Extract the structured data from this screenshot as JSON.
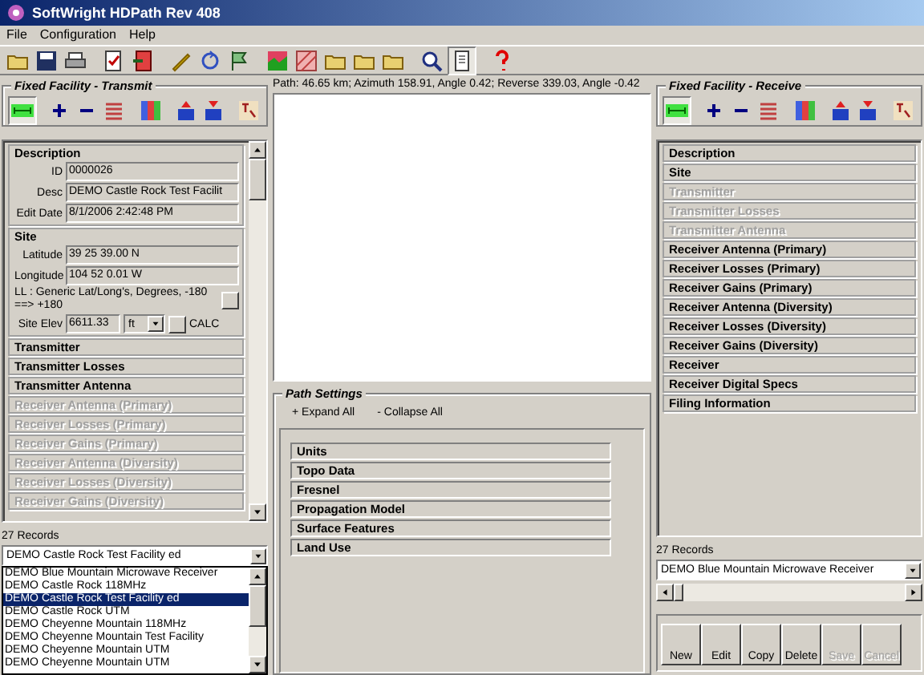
{
  "window": {
    "title": "SoftWright HDPath Rev 408"
  },
  "menu": [
    "File",
    "Configuration",
    "Help"
  ],
  "transmit": {
    "title": "Fixed Facility - Transmit",
    "sections": [
      {
        "title": "Description",
        "disabled": false,
        "fields": [
          {
            "label": "ID",
            "value": "0000026"
          },
          {
            "label": "Desc",
            "value": "DEMO Castle Rock Test Facilit"
          },
          {
            "label": "Edit Date",
            "value": "8/1/2006 2:42:48 PM"
          }
        ]
      },
      {
        "title": "Site",
        "disabled": false,
        "fields": [
          {
            "label": "Latitude",
            "value": "39 25 39.00 N"
          },
          {
            "label": "Longitude",
            "value": "104 52 0.01 W"
          }
        ],
        "note": "LL : Generic Lat/Long's, Degrees, -180 ==> +180",
        "elevation": {
          "label": "Site Elev",
          "value": "6611.33",
          "unit": "ft",
          "action": "CALC"
        }
      },
      {
        "title": "Transmitter",
        "disabled": false
      },
      {
        "title": "Transmitter Losses",
        "disabled": false
      },
      {
        "title": "Transmitter Antenna",
        "disabled": false
      },
      {
        "title": "Receiver Antenna (Primary)",
        "disabled": true
      },
      {
        "title": "Receiver Losses (Primary)",
        "disabled": true
      },
      {
        "title": "Receiver Gains (Primary)",
        "disabled": true
      },
      {
        "title": "Receiver Antenna (Diversity)",
        "disabled": true
      },
      {
        "title": "Receiver Losses (Diversity)",
        "disabled": true
      },
      {
        "title": "Receiver Gains (Diversity)",
        "disabled": true
      }
    ],
    "records": "27 Records",
    "combo": "DEMO Castle Rock Test Facility ed",
    "list": [
      {
        "text": "DEMO Blue Mountain Microwave Receiver",
        "selected": false
      },
      {
        "text": "DEMO Castle Rock 118MHz",
        "selected": false
      },
      {
        "text": "DEMO Castle Rock Test Facility ed",
        "selected": true
      },
      {
        "text": "DEMO Castle Rock UTM",
        "selected": false
      },
      {
        "text": "DEMO Cheyenne Mountain 118MHz",
        "selected": false
      },
      {
        "text": "DEMO Cheyenne Mountain Test Facility",
        "selected": false
      },
      {
        "text": "DEMO Cheyenne Mountain UTM",
        "selected": false
      },
      {
        "text": "DEMO Cheyenne Mountain UTM",
        "selected": false
      }
    ]
  },
  "path": {
    "info": "Path: 46.65 km; Azimuth 158.91, Angle 0.42; Reverse 339.03, Angle -0.42",
    "settings": {
      "title": "Path Settings",
      "expand": "+ Expand All",
      "collapse": "- Collapse All",
      "sections": [
        "Units",
        "Topo Data",
        "Fresnel",
        "Propagation Model",
        "Surface Features",
        "Land Use"
      ]
    }
  },
  "receive": {
    "title": "Fixed Facility - Receive",
    "sections": [
      {
        "title": "Description",
        "disabled": false
      },
      {
        "title": "Site",
        "disabled": false
      },
      {
        "title": "Transmitter",
        "disabled": true
      },
      {
        "title": "Transmitter Losses",
        "disabled": true
      },
      {
        "title": "Transmitter Antenna",
        "disabled": true
      },
      {
        "title": "Receiver Antenna (Primary)",
        "disabled": false
      },
      {
        "title": "Receiver Losses (Primary)",
        "disabled": false
      },
      {
        "title": "Receiver Gains (Primary)",
        "disabled": false
      },
      {
        "title": "Receiver Antenna (Diversity)",
        "disabled": false
      },
      {
        "title": "Receiver Losses (Diversity)",
        "disabled": false
      },
      {
        "title": "Receiver Gains (Diversity)",
        "disabled": false
      },
      {
        "title": "Receiver",
        "disabled": false
      },
      {
        "title": "Receiver Digital Specs",
        "disabled": false
      },
      {
        "title": "Filing Information",
        "disabled": false
      }
    ],
    "records": "27 Records",
    "combo": "DEMO Blue Mountain Microwave Receiver",
    "buttons": [
      {
        "label": "New",
        "disabled": false
      },
      {
        "label": "Edit",
        "disabled": false
      },
      {
        "label": "Copy",
        "disabled": false
      },
      {
        "label": "Delete",
        "disabled": false
      },
      {
        "label": "Save",
        "disabled": true
      },
      {
        "label": "Cancel",
        "disabled": true
      }
    ]
  }
}
